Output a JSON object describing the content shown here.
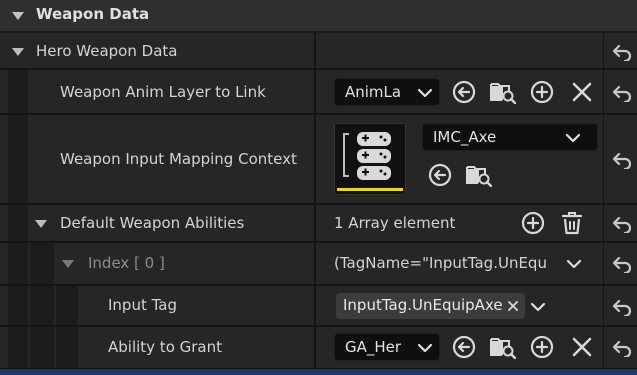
{
  "section": {
    "title": "Weapon Data"
  },
  "hero": {
    "label": "Hero Weapon Data"
  },
  "anim_layer": {
    "label": "Weapon Anim Layer to Link",
    "value": "AnimLa",
    "icons": [
      "use-selected-icon",
      "browse-icon",
      "add-icon",
      "clear-icon"
    ]
  },
  "input_mapping": {
    "label": "Weapon Input Mapping Context",
    "value": "IMC_Axe",
    "icons": [
      "use-selected-icon",
      "browse-icon"
    ]
  },
  "abilities": {
    "label": "Default Weapon Abilities",
    "count": "1 Array element",
    "icons": [
      "add-icon",
      "delete-icon"
    ]
  },
  "index0": {
    "label": "Index [ 0 ]",
    "value": "(TagName=\"InputTag.UnEqu"
  },
  "input_tag": {
    "label": "Input Tag",
    "value": "InputTag.UnEquipAxe"
  },
  "ability_grant": {
    "label": "Ability to Grant",
    "value": "GA_Her",
    "icons": [
      "use-selected-icon",
      "browse-icon",
      "add-icon",
      "clear-icon"
    ]
  },
  "colors": {
    "background": "#1a1a1a",
    "row": "#262626",
    "accent_bar": "#e7d533",
    "bottom_strip": "#1e3a66"
  }
}
